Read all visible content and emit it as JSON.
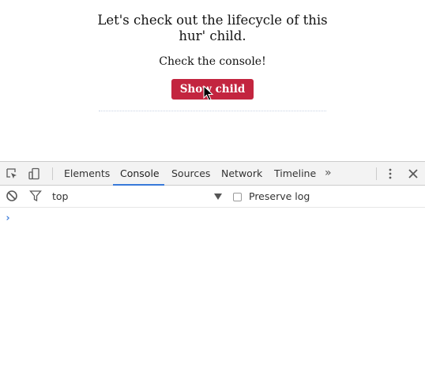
{
  "app": {
    "title_line1": "Let's check out the lifecycle of this",
    "title_line2": "hur' child.",
    "subtitle": "Check the console!",
    "button_label": "Show child",
    "button_color": "#c3253f"
  },
  "devtools": {
    "tabs": [
      {
        "label": "Elements",
        "active": false
      },
      {
        "label": "Console",
        "active": true
      },
      {
        "label": "Sources",
        "active": false
      },
      {
        "label": "Network",
        "active": false
      },
      {
        "label": "Timeline",
        "active": false
      }
    ],
    "more_tabs_label": "»",
    "context": "top",
    "preserve_log_label": "Preserve log",
    "preserve_log_checked": false,
    "prompt": "›",
    "accent_color": "#3879d9"
  },
  "icons": {
    "inspect": "inspect-element-icon",
    "device": "device-toolbar-icon",
    "menu": "kebab-menu-icon",
    "close": "close-icon",
    "clear": "clear-console-icon",
    "filter": "filter-icon",
    "cursor": "mouse-cursor-icon"
  }
}
